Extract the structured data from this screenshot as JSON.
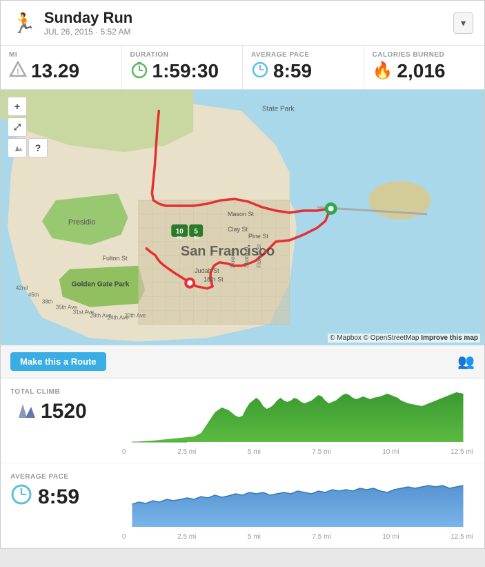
{
  "header": {
    "title": "Sunday Run",
    "subtitle": "JUL 26, 2015  ·  5:52 AM",
    "dropdown_label": "▾"
  },
  "stats": [
    {
      "label": "MI",
      "icon": "⚠",
      "icon_color": "#888",
      "value": "13.29"
    },
    {
      "label": "DURATION",
      "icon": "⏱",
      "icon_color": "#5cb85c",
      "value": "1:59:30"
    },
    {
      "label": "AVERAGE PACE",
      "icon": "🧭",
      "icon_color": "#5bc0de",
      "value": "8:59"
    },
    {
      "label": "CALORIES BURNED",
      "icon": "🔥",
      "icon_color": "#f0ad4e",
      "value": "2,016"
    }
  ],
  "map": {
    "attribution": "© Mapbox © OpenStreetMap",
    "improve_text": "Improve this map"
  },
  "map_controls": {
    "plus": "+",
    "expand": "⤢",
    "terrain": "⛰",
    "help": "?"
  },
  "route_bar": {
    "button_label": "Make this a Route"
  },
  "total_climb": {
    "label": "TOTAL CLIMB",
    "value": "1520",
    "axis": [
      "0",
      "2.5 mi",
      "5 mi",
      "7.5 mi",
      "10 mi",
      "12.5 mi"
    ]
  },
  "average_pace": {
    "label": "AVERAGE PACE",
    "value": "8:59",
    "axis": [
      "0",
      "2.5 mi",
      "5 mi",
      "7.5 mi",
      "10 mi",
      "12.5 mi"
    ]
  }
}
